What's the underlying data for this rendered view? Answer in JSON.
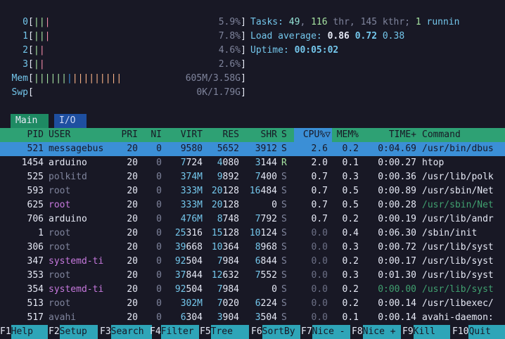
{
  "cpus": [
    {
      "label": "0",
      "bars": [
        {
          "c": "#a6e3a1",
          "t": "|"
        },
        {
          "c": "#a6e3a1",
          "t": "|"
        },
        {
          "c": "#f38ba8",
          "t": "|"
        }
      ],
      "value": "5.9%"
    },
    {
      "label": "1",
      "bars": [
        {
          "c": "#a6e3a1",
          "t": "|"
        },
        {
          "c": "#a6e3a1",
          "t": "|"
        },
        {
          "c": "#f38ba8",
          "t": "|"
        }
      ],
      "value": "7.8%"
    },
    {
      "label": "2",
      "bars": [
        {
          "c": "#a6e3a1",
          "t": "|"
        },
        {
          "c": "#f38ba8",
          "t": "|"
        }
      ],
      "value": "4.6%"
    },
    {
      "label": "3",
      "bars": [
        {
          "c": "#a6e3a1",
          "t": "|"
        },
        {
          "c": "#f38ba8",
          "t": "|"
        }
      ],
      "value": "2.6%"
    }
  ],
  "mem": {
    "label": "Mem",
    "value": "605M/3.58G",
    "bars": [
      {
        "c": "#a6e3a1",
        "t": "||||||"
      },
      {
        "c": "#3b8fd6",
        "t": "|"
      },
      {
        "c": "#fab387",
        "t": "|||||||||"
      }
    ]
  },
  "swp": {
    "label": "Swp",
    "value": "0K/1.79G"
  },
  "tasks": {
    "label": "Tasks:",
    "procs": "49",
    "sep1": ",",
    "threads": "116",
    "thr_label": "thr",
    "sep2": ",",
    "kthreads": "145",
    "kthr_label": "kthr",
    "sep3": ";",
    "running": "1",
    "run_label": "runnin"
  },
  "load": {
    "label": "Load average:",
    "one": "0.86",
    "five": "0.72",
    "fifteen": "0.38"
  },
  "uptime": {
    "label": "Uptime:",
    "value": "00:05:02"
  },
  "tabs": {
    "main": "Main",
    "io": "I/O"
  },
  "columns": {
    "pid": "PID",
    "user": "USER",
    "pri": "PRI",
    "ni": "NI",
    "virt": "VIRT",
    "res": "RES",
    "shr": "SHR",
    "s": "S",
    "cpu": "CPU%",
    "sort": "▽",
    "mem": "MEM%",
    "time": "TIME+",
    "cmd": "Command"
  },
  "processes": [
    {
      "pid": "521",
      "user": "messagebus",
      "pri": "20",
      "ni": "0",
      "virt": "9580",
      "res": "5652",
      "shr": "3912",
      "s": "S",
      "cpu": "2.6",
      "mem": "0.2",
      "time": "0:04.69",
      "cmd": "/usr/bin/dbus",
      "selected": true
    },
    {
      "pid": "1454",
      "user": "arduino",
      "pri": "20",
      "ni": "0",
      "virt": "7724",
      "res": "4080",
      "shr": "3144",
      "s": "R",
      "cpu": "2.0",
      "mem": "0.1",
      "time": "0:00.27",
      "cmd": "htop"
    },
    {
      "pid": "525",
      "user": "polkitd",
      "pri": "20",
      "ni": "0",
      "virt": "374M",
      "res": "9892",
      "shr": "7400",
      "s": "S",
      "cpu": "0.7",
      "mem": "0.3",
      "time": "0:00.36",
      "cmd": "/usr/lib/polk"
    },
    {
      "pid": "593",
      "user": "root",
      "pri": "20",
      "ni": "0",
      "virt": "333M",
      "res": "20128",
      "shr": "16484",
      "s": "S",
      "cpu": "0.7",
      "mem": "0.5",
      "time": "0:00.89",
      "cmd": "/usr/sbin/Net"
    },
    {
      "pid": "625",
      "user": "root",
      "pri": "20",
      "ni": "0",
      "virt": "333M",
      "res": "20128",
      "shr": "0",
      "s": "S",
      "cpu": "0.7",
      "mem": "0.5",
      "time": "0:00.28",
      "cmd": "/usr/sbin/Net"
    },
    {
      "pid": "706",
      "user": "arduino",
      "pri": "20",
      "ni": "0",
      "virt": "476M",
      "res": "8748",
      "shr": "7792",
      "s": "S",
      "cpu": "0.7",
      "mem": "0.2",
      "time": "0:00.19",
      "cmd": "/usr/lib/andr"
    },
    {
      "pid": "1",
      "user": "root",
      "pri": "20",
      "ni": "0",
      "virt": "25316",
      "res": "15128",
      "shr": "10124",
      "s": "S",
      "cpu": "0.0",
      "mem": "0.4",
      "time": "0:06.30",
      "cmd": "/sbin/init"
    },
    {
      "pid": "306",
      "user": "root",
      "pri": "20",
      "ni": "0",
      "virt": "39668",
      "res": "10364",
      "shr": "8968",
      "s": "S",
      "cpu": "0.0",
      "mem": "0.3",
      "time": "0:00.72",
      "cmd": "/usr/lib/syst"
    },
    {
      "pid": "347",
      "user": "systemd-ti",
      "pri": "20",
      "ni": "0",
      "virt": "92504",
      "res": "7984",
      "shr": "6844",
      "s": "S",
      "cpu": "0.0",
      "mem": "0.2",
      "time": "0:00.17",
      "cmd": "/usr/lib/syst"
    },
    {
      "pid": "353",
      "user": "root",
      "pri": "20",
      "ni": "0",
      "virt": "37844",
      "res": "12632",
      "shr": "7552",
      "s": "S",
      "cpu": "0.0",
      "mem": "0.3",
      "time": "0:01.30",
      "cmd": "/usr/lib/syst"
    },
    {
      "pid": "354",
      "user": "systemd-ti",
      "pri": "20",
      "ni": "0",
      "virt": "92504",
      "res": "7984",
      "shr": "0",
      "s": "S",
      "cpu": "0.0",
      "mem": "0.2",
      "time": "0:00.00",
      "cmd": "/usr/lib/syst"
    },
    {
      "pid": "513",
      "user": "root",
      "pri": "20",
      "ni": "0",
      "virt": "302M",
      "res": "7020",
      "shr": "6224",
      "s": "S",
      "cpu": "0.0",
      "mem": "0.2",
      "time": "0:00.14",
      "cmd": "/usr/libexec/"
    },
    {
      "pid": "517",
      "user": "avahi",
      "pri": "20",
      "ni": "0",
      "virt": "6304",
      "res": "3904",
      "shr": "3504",
      "s": "S",
      "cpu": "0.0",
      "mem": "0.1",
      "time": "0:00.14",
      "cmd": "avahi-daemon:"
    }
  ],
  "footer": [
    {
      "key": "F1",
      "label": "Help"
    },
    {
      "key": "F2",
      "label": "Setup"
    },
    {
      "key": "F3",
      "label": "Search"
    },
    {
      "key": "F4",
      "label": "Filter"
    },
    {
      "key": "F5",
      "label": "Tree"
    },
    {
      "key": "F6",
      "label": "SortBy"
    },
    {
      "key": "F7",
      "label": "Nice -"
    },
    {
      "key": "F8",
      "label": "Nice +"
    },
    {
      "key": "F9",
      "label": "Kill"
    },
    {
      "key": "F10",
      "label": "Quit"
    }
  ]
}
